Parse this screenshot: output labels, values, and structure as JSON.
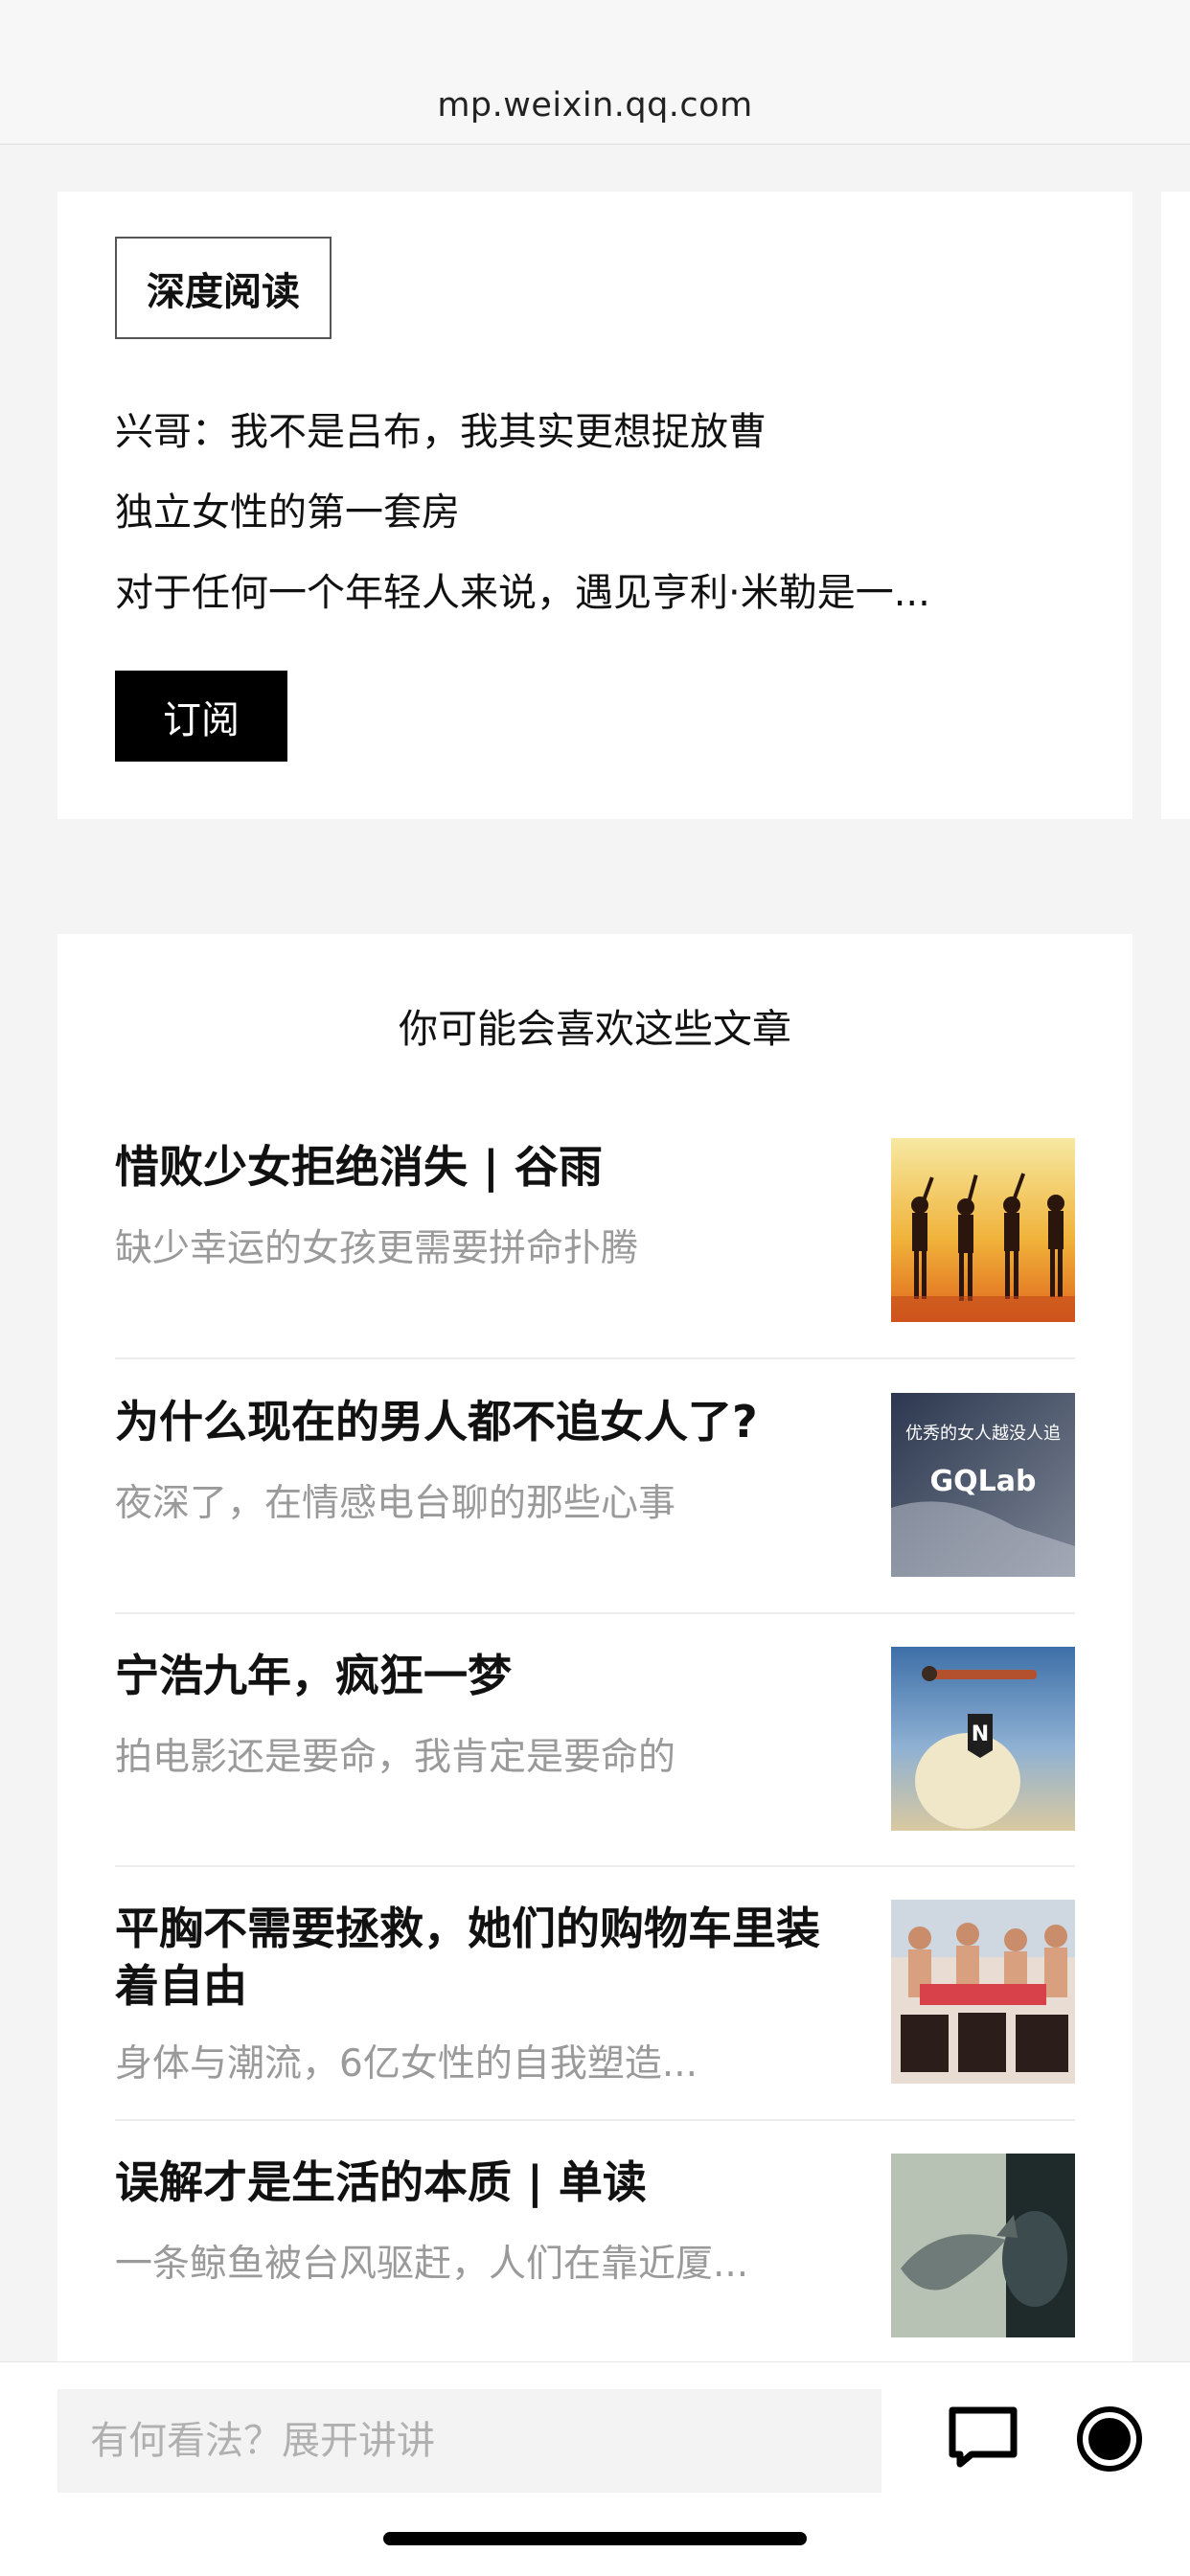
{
  "browser": {
    "domain": "mp.weixin.qq.com"
  },
  "account_card": {
    "tag": "深度阅读",
    "recent_articles": [
      "兴哥：我不是吕布，我其实更想捉放曹",
      "独立女性的第一套房",
      "对于任何一个年轻人来说，遇见亨利·米勒是一..."
    ],
    "subscribe_label": "订阅"
  },
  "recommendations": {
    "title": "你可能会喜欢这些文章",
    "articles": [
      {
        "title": "惜败少女拒绝消失 | 谷雨",
        "subtitle": "缺少幸运的女孩更需要拼命扑腾"
      },
      {
        "title": "为什么现在的男人都不追女人了?",
        "subtitle": "夜深了，在情感电台聊的那些心事",
        "thumb_text": "优秀的女人越没人追",
        "thumb_logo": "GQLab"
      },
      {
        "title": "宁浩九年，疯狂一梦",
        "subtitle": "拍电影还是要命，我肯定是要命的",
        "thumb_badge": "N"
      },
      {
        "title": "平胸不需要拯救，她们的购物车里装着自由",
        "subtitle": "身体与潮流，6亿女性的自我塑造..."
      },
      {
        "title": "误解才是生活的本质 | 单读",
        "subtitle": "一条鲸鱼被台风驱赶，人们在靠近厦..."
      }
    ]
  },
  "bottom_bar": {
    "comment_placeholder": "有何看法？展开讲讲",
    "icons": [
      "comment-icon",
      "record-icon"
    ]
  }
}
